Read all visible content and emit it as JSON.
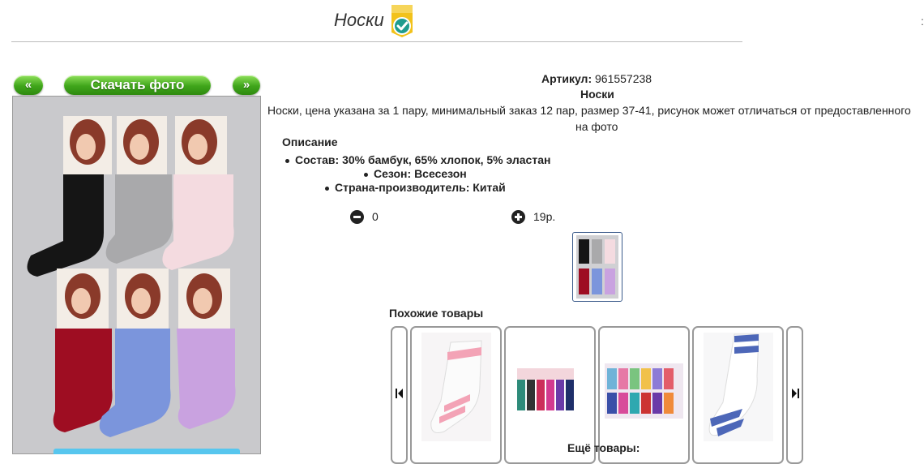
{
  "header": {
    "title": "Носки",
    "verified_icon": "verified-badge-icon",
    "corner_mark": ":"
  },
  "nav": {
    "prev_label": "«",
    "download_label": "Скачать фото",
    "next_label": "»"
  },
  "product": {
    "artikul_label": "Артикул:",
    "artikul_value": "961557238",
    "name": "Носки",
    "description_line1": "Носки, цена указана за 1 пару, минимальный заказ 12 пар, размер 37-41, рисунок может отличаться от предоставленного",
    "description_line2": "на фото",
    "description_title": "Описание",
    "specs": [
      "Состав: 30% бамбук, 65% хлопок, 5% эластан",
      "Сезон: Всесезон",
      "Страна-производитель: Китай"
    ]
  },
  "cart": {
    "minus_icon": "minus-circle-icon",
    "quantity": "0",
    "plus_icon": "plus-circle-icon",
    "price": "19р."
  },
  "related": {
    "similar_title": "Похожие товары",
    "more_title": "Ещё товары:",
    "prev_icon": "triangle-left-icon",
    "next_icon": "triangle-right-icon"
  },
  "colors": {
    "button_green": "#3fa51a",
    "badge_yellow": "#f2c21b",
    "badge_teal": "#1f9c8e",
    "accent_blue": "#57c6ee"
  }
}
